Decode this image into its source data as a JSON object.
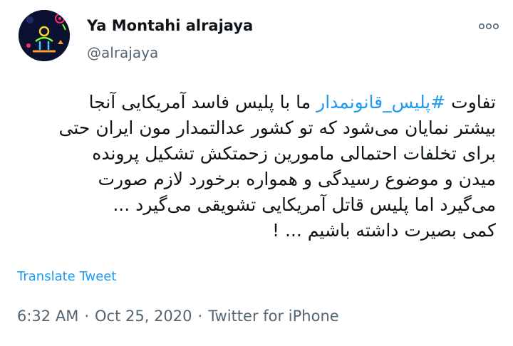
{
  "author": {
    "display_name": "Ya Montahi alrajaya",
    "handle": "@alrajaya",
    "avatar_icon": "neon-figure-avatar"
  },
  "more_icon": "more-horizontal-icon",
  "tweet": {
    "line1_pre": "تفاوت ",
    "hashtag": "#پلیس_قانونمدار",
    "line1_post": " ما با پلیس فاسد آمریکایی آنجا",
    "line2": "بیشتر نمایان می‌شود که تو کشور عدالتمدار مون ایران حتی",
    "line3": "برای تخلفات احتمالی مامورین زحمتکش تشکیل پرونده",
    "line4": "میدن و موضوع رسیدگی و همواره برخورد لازم صورت",
    "line5": "می‌گیرد اما پلیس قاتل آمریکایی تشویقی می‌گیرد ...",
    "line6": "کمی بصیرت داشته باشیم ... !"
  },
  "translate_label": "Translate Tweet",
  "meta": {
    "time": "6:32 AM",
    "date": "Oct 25, 2020",
    "source": "Twitter for iPhone",
    "separator": "·"
  },
  "colors": {
    "accent": "#1d9bf0",
    "secondary_text": "#536471",
    "primary_text": "#0f1419"
  }
}
